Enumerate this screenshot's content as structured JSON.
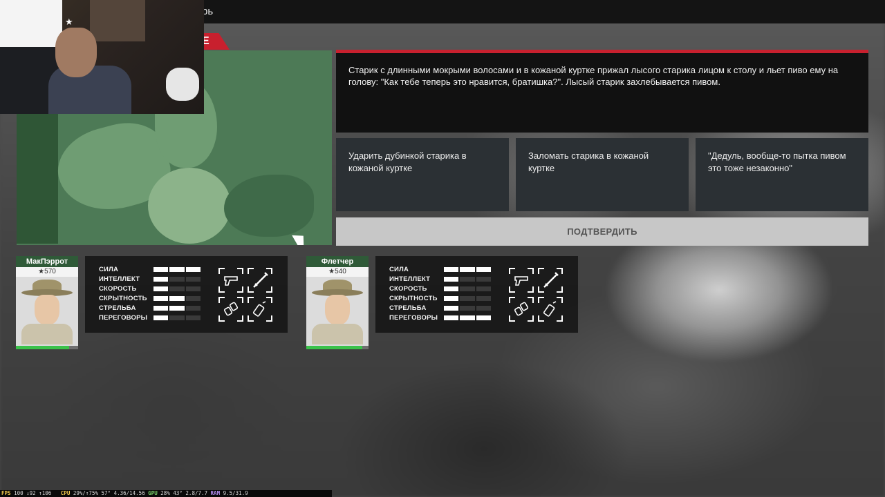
{
  "window": {
    "title_fragment": "рь",
    "tab_letter": "E"
  },
  "webcam": {
    "overlay_star": "★"
  },
  "event": {
    "text": "Старик с длинными мокрыми волосами и в кожаной куртке прижал лысого старика лицом к столу и льет пиво ему на голову: \"Как тебе теперь это нравится, братишка?\". Лысый старик захлебывается пивом."
  },
  "choices": [
    {
      "label": "Ударить дубинкой старика в кожаной куртке"
    },
    {
      "label": "Заломать старика в кожаной куртке"
    },
    {
      "label": "\"Дедуль, вообще-то пытка пивом это тоже незаконно\""
    }
  ],
  "confirm_label": "ПОДТВЕРДИТЬ",
  "characters": [
    {
      "name": "МакПэррот",
      "score": "★570",
      "health_fraction": 0.85,
      "stats": [
        {
          "label": "СИЛА",
          "level": 3,
          "max": 3
        },
        {
          "label": "ИНТЕЛЛЕКТ",
          "level": 1,
          "max": 3
        },
        {
          "label": "СКОРОСТЬ",
          "level": 1,
          "max": 3
        },
        {
          "label": "СКРЫТНОСТЬ",
          "level": 2,
          "max": 3
        },
        {
          "label": "СТРЕЛЬБА",
          "level": 2,
          "max": 3
        },
        {
          "label": "ПЕРЕГОВОРЫ",
          "level": 1,
          "max": 3
        }
      ],
      "equipment": [
        "pistol-icon",
        "baton-icon",
        "handcuffs-icon",
        "spray-icon"
      ]
    },
    {
      "name": "Флетчер",
      "score": "★540",
      "health_fraction": 0.9,
      "stats": [
        {
          "label": "СИЛА",
          "level": 3,
          "max": 3
        },
        {
          "label": "ИНТЕЛЛЕКТ",
          "level": 1,
          "max": 3
        },
        {
          "label": "СКОРОСТЬ",
          "level": 1,
          "max": 3
        },
        {
          "label": "СКРЫТНОСТЬ",
          "level": 1,
          "max": 3
        },
        {
          "label": "СТРЕЛЬБА",
          "level": 1,
          "max": 3
        },
        {
          "label": "ПЕРЕГОВОРЫ",
          "level": 3,
          "max": 3
        }
      ],
      "equipment": [
        "pistol-icon",
        "baton-icon",
        "handcuffs-icon",
        "spray-icon"
      ]
    }
  ],
  "perf": {
    "fps_label": "FPS",
    "fps_value": "100 ↓92 ↑106",
    "cpu_label": "CPU",
    "cpu_value": "29%/↑75%",
    "cpu_temp": "57°",
    "cpu_clock": "4.36/14.56",
    "gpu_label": "GPU",
    "gpu_value": "28%",
    "gpu_temp": "43°",
    "gpu_mem": "2.8/7.7",
    "ram_label": "RAM",
    "ram_value": "9.5/31.9"
  },
  "colors": {
    "accent_red": "#c8202e",
    "health_green": "#3ac24a",
    "name_green": "#2f5a38"
  }
}
